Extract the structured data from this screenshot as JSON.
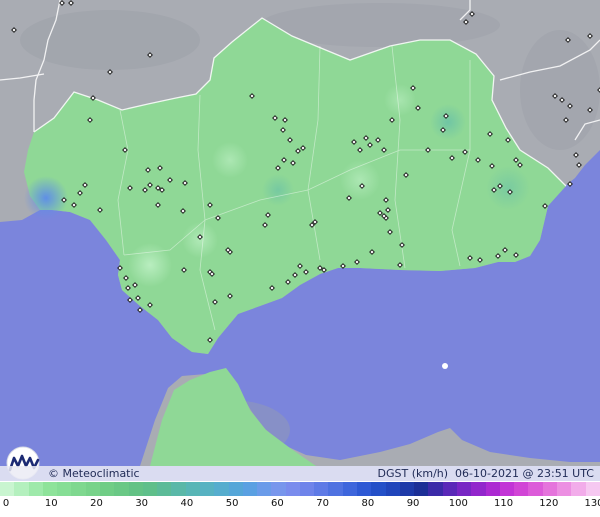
{
  "map": {
    "credit": "© Meteoclimatic",
    "product": "DGST (km/h)",
    "date": "06-10-2021",
    "at": "@",
    "time": "23:51 UTC",
    "logo_icon": "meteoclimatic-wave-logo-icon",
    "colors": {
      "sea": "#7b85dc",
      "land_outside": "#a9acb3",
      "land_region": "#8fd896",
      "border": "#ffffff"
    }
  },
  "legend": {
    "unit": "km/h",
    "ticks": [
      "0",
      "10",
      "20",
      "30",
      "40",
      "50",
      "60",
      "70",
      "80",
      "90",
      "100",
      "110",
      "120",
      "130"
    ],
    "colors": [
      "#c9f5d0",
      "#b4f0be",
      "#9ee9aa",
      "#8ee39a",
      "#86de95",
      "#7fd88f",
      "#78d38a",
      "#70cd86",
      "#6ac885",
      "#63c285",
      "#5fbf8a",
      "#5cbb98",
      "#5ab8a8",
      "#58b6b6",
      "#57b2c2",
      "#56adce",
      "#55a6d8",
      "#5aa0e2",
      "#6a9be9",
      "#7896ec",
      "#7a8ced",
      "#6f84ea",
      "#5f7be6",
      "#4f72e1",
      "#3e66dc",
      "#2e59d4",
      "#2450c8",
      "#2045bb",
      "#1e3aa8",
      "#1c2f96",
      "#3b2aa8",
      "#5a28b8",
      "#7826c4",
      "#9226cc",
      "#ac2ad2",
      "#c234d6",
      "#d145d6",
      "#dc5bd9",
      "#e574dc",
      "#ec8fe2",
      "#f2acea",
      "#f6c8f1"
    ]
  }
}
